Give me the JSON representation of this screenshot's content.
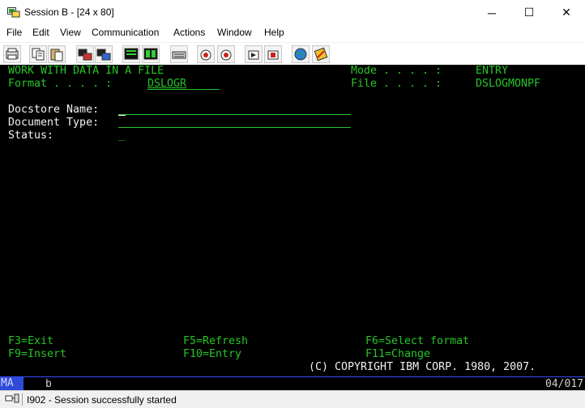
{
  "window": {
    "title": "Session B - [24 x 80]",
    "minimize": "─",
    "maximize": "☐",
    "close": "✕"
  },
  "menu": {
    "items": [
      "File",
      "Edit",
      "View",
      "Communication",
      "Actions",
      "Window",
      "Help"
    ]
  },
  "toolbar": {
    "icons": [
      "print-screen-icon",
      "copy-icon",
      "paste-icon",
      "send-icon",
      "receive-icon",
      "display-icon",
      "macro-icon",
      "keyboard-icon",
      "record-icon",
      "play-icon",
      "stop-icon",
      "quit-icon",
      "globe-icon",
      "edit-icon"
    ]
  },
  "screen": {
    "title": "WORK WITH DATA IN A FILE",
    "mode_label": "Mode . . . . :",
    "mode_value": "ENTRY",
    "format_label": "Format . . . . :",
    "format_value": "DSLOGR",
    "file_label": "File . . . . :",
    "file_value": "DSLOGMONPF",
    "fields": [
      {
        "label": "Docstore Name:"
      },
      {
        "label": "Document Type:"
      },
      {
        "label": "Status:",
        "value": "_"
      }
    ],
    "fkeys": {
      "f3": "F3=Exit",
      "f5": "F5=Refresh",
      "f6": "F6=Select format",
      "f9": "F9=Insert",
      "f10": "F10=Entry",
      "f11": "F11=Change"
    },
    "copyright": "(C) COPYRIGHT IBM CORP. 1980, 2007."
  },
  "oia": {
    "indicator": "MA",
    "letter": "b",
    "cursor_pos": "04/017"
  },
  "status": {
    "message": "I902 - Session successfully started"
  },
  "colors": {
    "terminal_bg": "#000000",
    "terminal_text": "#27c527",
    "oia_highlight": "#2f49d8"
  }
}
